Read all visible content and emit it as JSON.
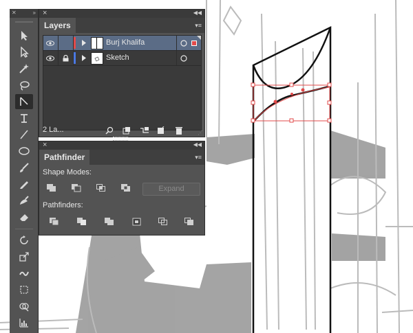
{
  "layers_panel": {
    "tab_label": "Layers",
    "layers": [
      {
        "name": "Burj Khalifa",
        "color": "#e24a4a",
        "selected": true,
        "locked": false,
        "visible": true
      },
      {
        "name": "Sketch",
        "color": "#4a78e2",
        "selected": false,
        "locked": true,
        "visible": true
      }
    ],
    "footer_count": "2 La..."
  },
  "pathfinder_panel": {
    "tab_label": "Pathfinder",
    "shape_modes_label": "Shape Modes:",
    "expand_label": "Expand",
    "pathfinders_label": "Pathfinders:"
  },
  "colors": {
    "panel_bg": "#535353",
    "selection_row": "#5b6c86",
    "selection_bbox": "#e24a4a"
  },
  "tools": [
    "selection-tool-icon",
    "direct-selection-tool-icon",
    "magic-wand-tool-icon",
    "lasso-tool-icon",
    "pen-tool-icon",
    "type-tool-icon",
    "line-tool-icon",
    "ellipse-tool-icon",
    "paintbrush-tool-icon",
    "pencil-tool-icon",
    "blob-brush-tool-icon",
    "eraser-tool-icon",
    "rotate-tool-icon",
    "scale-tool-icon",
    "warp-tool-icon",
    "free-transform-tool-icon",
    "shape-builder-tool-icon",
    "graph-tool-icon"
  ]
}
